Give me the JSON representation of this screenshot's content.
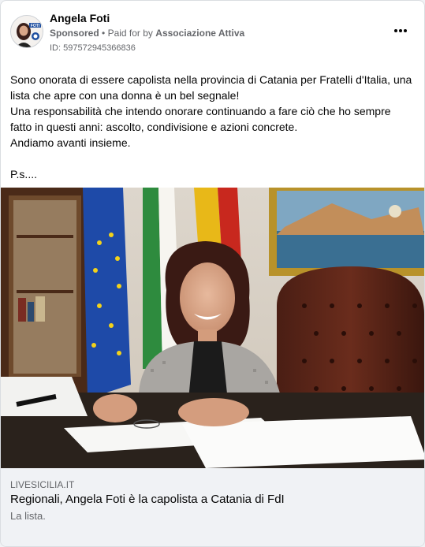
{
  "post": {
    "author": "Angela Foti",
    "sponsored": "Sponsored",
    "paid_prefix": "Paid for by",
    "paid_by": "Associazione Attiva",
    "ad_id": "ID: 597572945366836",
    "more_icon": "ellipsis-icon",
    "avatar_badge": "FOTI"
  },
  "body": {
    "lines": [
      "Sono onorata di essere capolista nella provincia di Catania per Fratelli d'Italia, una lista che apre con una donna è un bel segnale!",
      "Una responsabilità che intendo onorare continuando a fare ciò che ho sempre fatto in questi anni: ascolto, condivisione e azioni concrete.",
      "Andiamo avanti insieme.",
      "",
      "P.s...."
    ]
  },
  "link": {
    "domain": "LIVESICILIA.IT",
    "title": "Regionali, Angela Foti è la capolista a Catania di FdI",
    "description": "La lista."
  },
  "colors": {
    "text_primary": "#050505",
    "text_secondary": "#65676b",
    "link_bg": "#f0f2f5",
    "eu_blue": "#1e4aa8",
    "eu_star": "#f3d21a"
  }
}
